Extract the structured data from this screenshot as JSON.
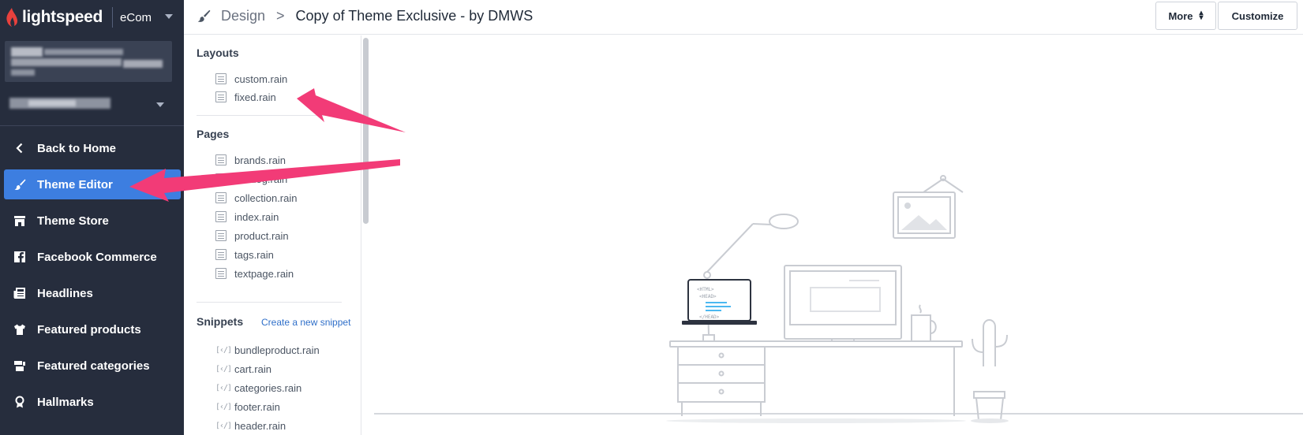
{
  "brand": {
    "name": "lightspeed",
    "app": "eCom"
  },
  "nav": [
    {
      "label": "Back to Home",
      "icon": "chevron-left-icon",
      "active": false
    },
    {
      "label": "Theme Editor",
      "icon": "paintbrush-icon",
      "active": true
    },
    {
      "label": "Theme Store",
      "icon": "storefront-icon",
      "active": false
    },
    {
      "label": "Facebook Commerce",
      "icon": "facebook-icon",
      "active": false
    },
    {
      "label": "Headlines",
      "icon": "newspaper-icon",
      "active": false
    },
    {
      "label": "Featured products",
      "icon": "tshirt-icon",
      "active": false
    },
    {
      "label": "Featured categories",
      "icon": "categories-icon",
      "active": false
    },
    {
      "label": "Hallmarks",
      "icon": "award-icon",
      "active": false
    }
  ],
  "header": {
    "breadcrumb_root": "Design",
    "breadcrumb_sep": ">",
    "title": "Copy of Theme Exclusive - by DMWS",
    "more_label": "More",
    "customize_label": "Customize"
  },
  "files": {
    "layouts_title": "Layouts",
    "layouts": [
      "custom.rain",
      "fixed.rain"
    ],
    "pages_title": "Pages",
    "pages": [
      "brands.rain",
      "catalog.rain",
      "collection.rain",
      "index.rain",
      "product.rain",
      "tags.rain",
      "textpage.rain"
    ],
    "snippets_title": "Snippets",
    "snippets_link": "Create a new snippet",
    "snippets": [
      "bundleproduct.rain",
      "cart.rain",
      "categories.rain",
      "footer.rain",
      "header.rain"
    ]
  },
  "illustration": {
    "laptop_line1": "<HTML>",
    "laptop_line2": "<HEAD>",
    "laptop_line3": "</HEAD>"
  },
  "colors": {
    "sidebar_bg": "#262d3d",
    "active_bg": "#3d7ee0",
    "annotation_arrow": "#f23b77",
    "link": "#2f6fc9"
  }
}
